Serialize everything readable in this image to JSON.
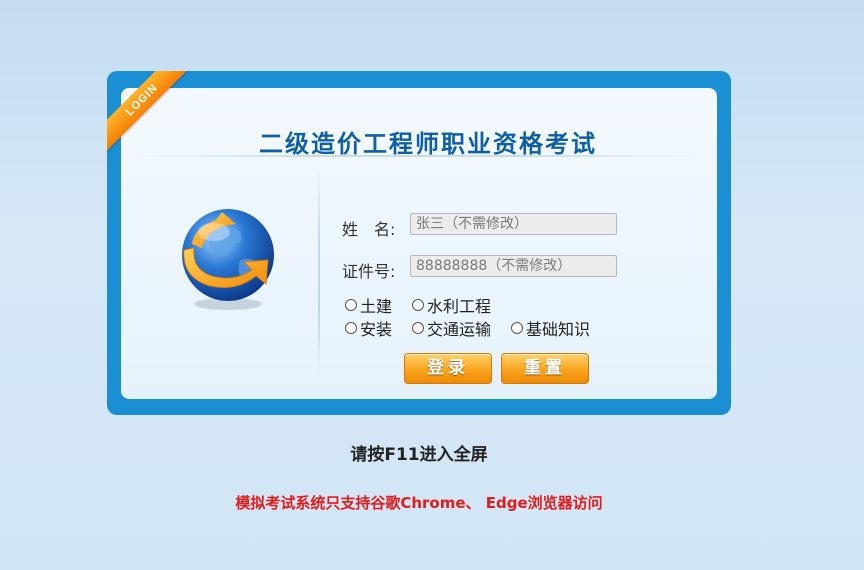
{
  "ribbon": {
    "label": "LOGIN"
  },
  "title": "二级造价工程师职业资格考试",
  "form": {
    "name_label": "姓　名:",
    "name_value": "张三（不需修改）",
    "id_label": "证件号:",
    "id_value": "88888888（不需修改）",
    "options": [
      "土建",
      "水利工程",
      "安装",
      "交通运输",
      "基础知识"
    ]
  },
  "buttons": {
    "login": "登录",
    "reset": "重置"
  },
  "fullscreen_hint": "请按F11进入全屏",
  "browser_warning": "模拟考试系统只支持谷歌Chrome、 Edge浏览器访问",
  "colors": {
    "frame": "#1a8fd4",
    "title": "#0d5fa6",
    "button": "#f9a41e",
    "warning": "#e41b1b"
  },
  "icons": [
    "globe-arrow-icon"
  ]
}
